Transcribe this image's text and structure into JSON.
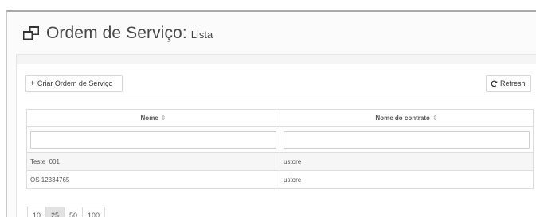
{
  "header": {
    "title": "Ordem de Serviço:",
    "subtitle": "Lista"
  },
  "toolbar": {
    "create_label": "Criar Ordem de Serviço",
    "refresh_label": "Refresh"
  },
  "table": {
    "columns": [
      "Nome",
      "Nome do contrato"
    ],
    "sort_glyph": "⇕",
    "rows": [
      [
        "Teste_001",
        "ustore"
      ],
      [
        "OS 12334765",
        "ustore"
      ]
    ]
  },
  "pagination": {
    "sizes": [
      "10",
      "25",
      "50",
      "100"
    ],
    "selected": "25"
  },
  "icons": {
    "header": "clone-icon",
    "create": "plus-icon",
    "refresh": "refresh-icon"
  },
  "colors": {
    "title": "#474747",
    "active_page": "#e2e2e2"
  }
}
